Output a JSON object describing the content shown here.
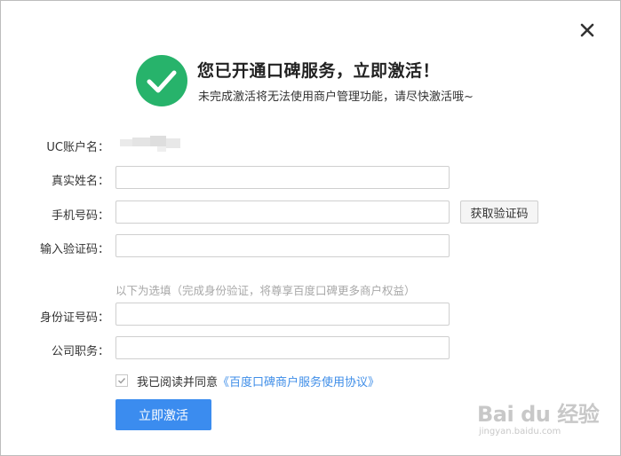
{
  "header": {
    "title": "您已开通口碑服务，立即激活！",
    "subtitle": "未完成激活将无法使用商户管理功能，请尽快激活哦~"
  },
  "icons": {
    "close": "close-icon",
    "success": "check-circle-icon",
    "checkbox": "checkmark-icon"
  },
  "colors": {
    "success": "#27b36b",
    "primary": "#3b8cef",
    "link": "#3f8ee8"
  },
  "form": {
    "username_label": "UC账户名：",
    "realname_label": "真实姓名：",
    "realname_value": "",
    "phone_label": "手机号码：",
    "phone_value": "",
    "get_code_label": "获取验证码",
    "code_label": "输入验证码：",
    "code_value": "",
    "optional_hint": "以下为选填（完成身份验证，将尊享百度口碑更多商户权益）",
    "idcard_label": "身份证号码：",
    "idcard_value": "",
    "position_label": "公司职务：",
    "position_value": ""
  },
  "agreement": {
    "checked": true,
    "text": "我已阅读并同意",
    "link": "《百度口碑商户服务使用协议》"
  },
  "submit_label": "立即激活",
  "watermark": {
    "main": "Bai du 经验",
    "sub": "jingyan.baidu.com"
  }
}
